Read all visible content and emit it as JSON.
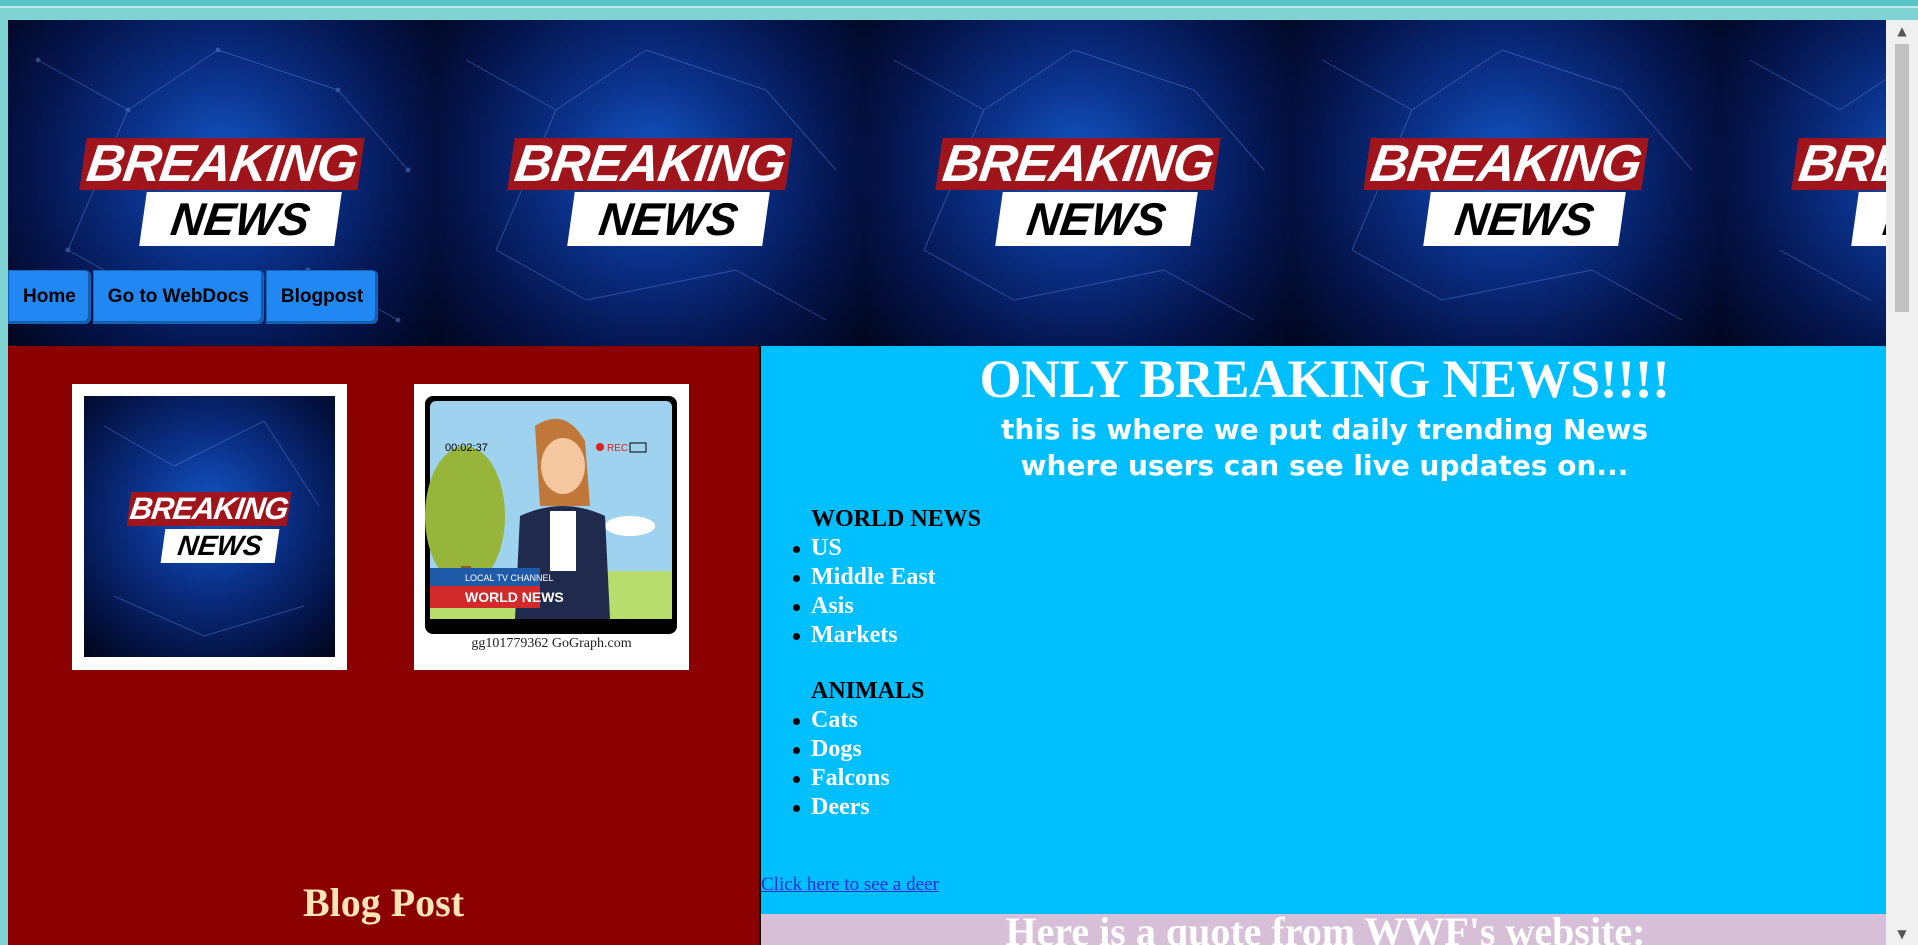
{
  "header": {
    "logo_line1": "BREAKING",
    "logo_line2": "NEWS"
  },
  "nav": {
    "items": [
      {
        "label": "Home"
      },
      {
        "label": "Go to WebDocs"
      },
      {
        "label": "Blogpost"
      }
    ]
  },
  "left": {
    "thumb1": {
      "logo_line1": "BREAKING",
      "logo_line2": "NEWS"
    },
    "thumb2": {
      "timer": "00:02:37",
      "rec": "REC",
      "channel": "LOCAL TV CHANNEL",
      "banner": "WORLD NEWS",
      "caption": "gg101779362 GoGraph.com"
    },
    "blog_title": "Blog Post"
  },
  "main": {
    "title": "ONLY BREAKING NEWS!!!!",
    "subtitle_line1": "this is where we put daily trending News",
    "subtitle_line2": "where users can see live updates on...",
    "sections": [
      {
        "heading": "WORLD NEWS",
        "items": [
          "US",
          "Middle East",
          "Asis",
          "Markets"
        ]
      },
      {
        "heading": "ANIMALS",
        "items": [
          "Cats",
          "Dogs",
          "Falcons",
          "Deers"
        ]
      }
    ],
    "deer_link": "Click here to see a deer",
    "quote_heading": "Here is a quote from WWF's website:"
  },
  "colors": {
    "page_bg": "#7fd3d3",
    "left_bg": "#8b0000",
    "right_bg": "#00bfff",
    "nav_button": "#2188f3",
    "quote_bg": "#d8bfd8"
  }
}
